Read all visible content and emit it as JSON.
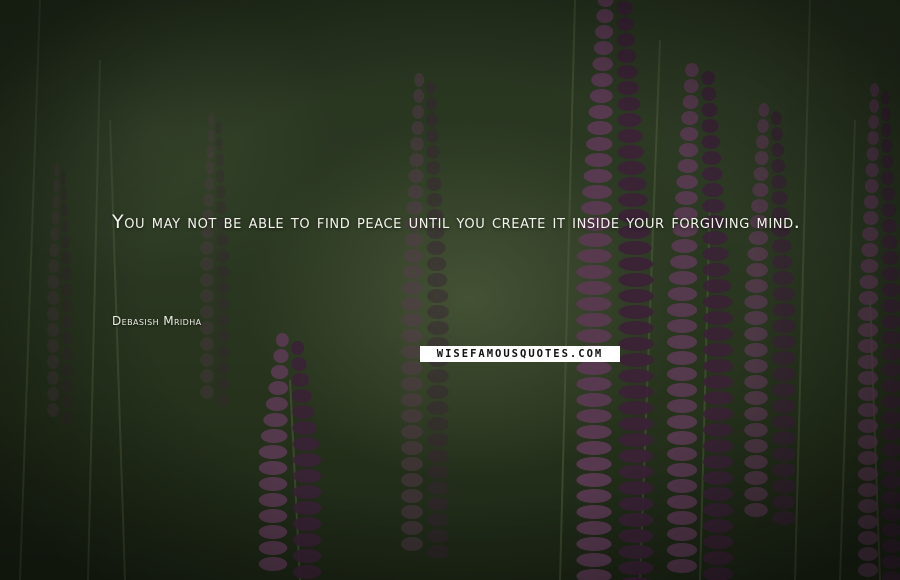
{
  "quote": {
    "text": "You may not be able to find peace until you create it inside your forgiving mind.",
    "author": "Debasish Mridha"
  },
  "watermark": "WISEFAMOUSQUOTES.COM",
  "scene": {
    "background_colors": [
      "#27341f",
      "#2b3822",
      "#1d2716"
    ],
    "flower_color": "#3a2236",
    "flower_highlight": "#5a3a52",
    "stem_color": "#4e5d3c",
    "text_color": "#f4f4ec"
  }
}
